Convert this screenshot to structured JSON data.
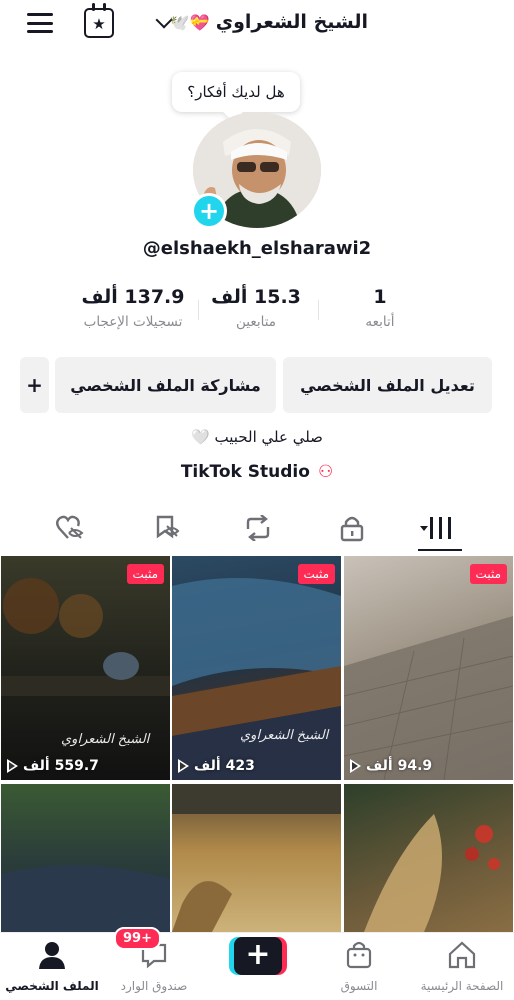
{
  "header": {
    "title": "الشيخ الشعراوي",
    "title_emojis": "💝🕊️",
    "chevron_icon": "chevron-down-icon",
    "menu_icon": "hamburger-icon",
    "calendar_icon": "calendar-star-icon"
  },
  "bubble": {
    "text": "هل لديك أفكار؟"
  },
  "profile": {
    "username": "@elshaekh_elsharawi2",
    "bio": "صلي علي الحبيب 🤍",
    "studio": "TikTok Studio"
  },
  "stats": [
    {
      "num": "1",
      "label": "أتابعه"
    },
    {
      "num": "15.3 ألف",
      "label": "متابعين"
    },
    {
      "num": "137.9 ألف",
      "label": "تسجيلات الإعجاب"
    }
  ],
  "buttons": {
    "edit": "تعديل الملف الشخصي",
    "share": "مشاركة الملف الشخصي",
    "add_friend": "+"
  },
  "tabs": [
    "videos-grid-icon",
    "lock-icon",
    "repost-icon",
    "favorites-icon",
    "liked-icon"
  ],
  "videos": [
    {
      "pinned": "مثبت",
      "views": "94.9 ألف",
      "caption": ""
    },
    {
      "pinned": "مثبت",
      "views": "423 ألف",
      "caption": "الشيخ الشعراوي"
    },
    {
      "pinned": "مثبت",
      "views": "559.7 ألف",
      "caption": "الشيخ الشعراوي"
    },
    {
      "pinned": "",
      "views": "",
      "caption": ""
    },
    {
      "pinned": "",
      "views": "",
      "caption": ""
    },
    {
      "pinned": "",
      "views": "",
      "caption": ""
    }
  ],
  "nav": {
    "home": "الصفحة الرئيسية",
    "shop": "التسوق",
    "create": "+",
    "inbox": "صندوق الوارد",
    "inbox_badge": "99+",
    "profile": "الملف الشخصي"
  },
  "colors": {
    "accent": "#fe2c55",
    "cyan": "#20d5ec",
    "text": "#161823",
    "muted": "#8a8b91"
  }
}
